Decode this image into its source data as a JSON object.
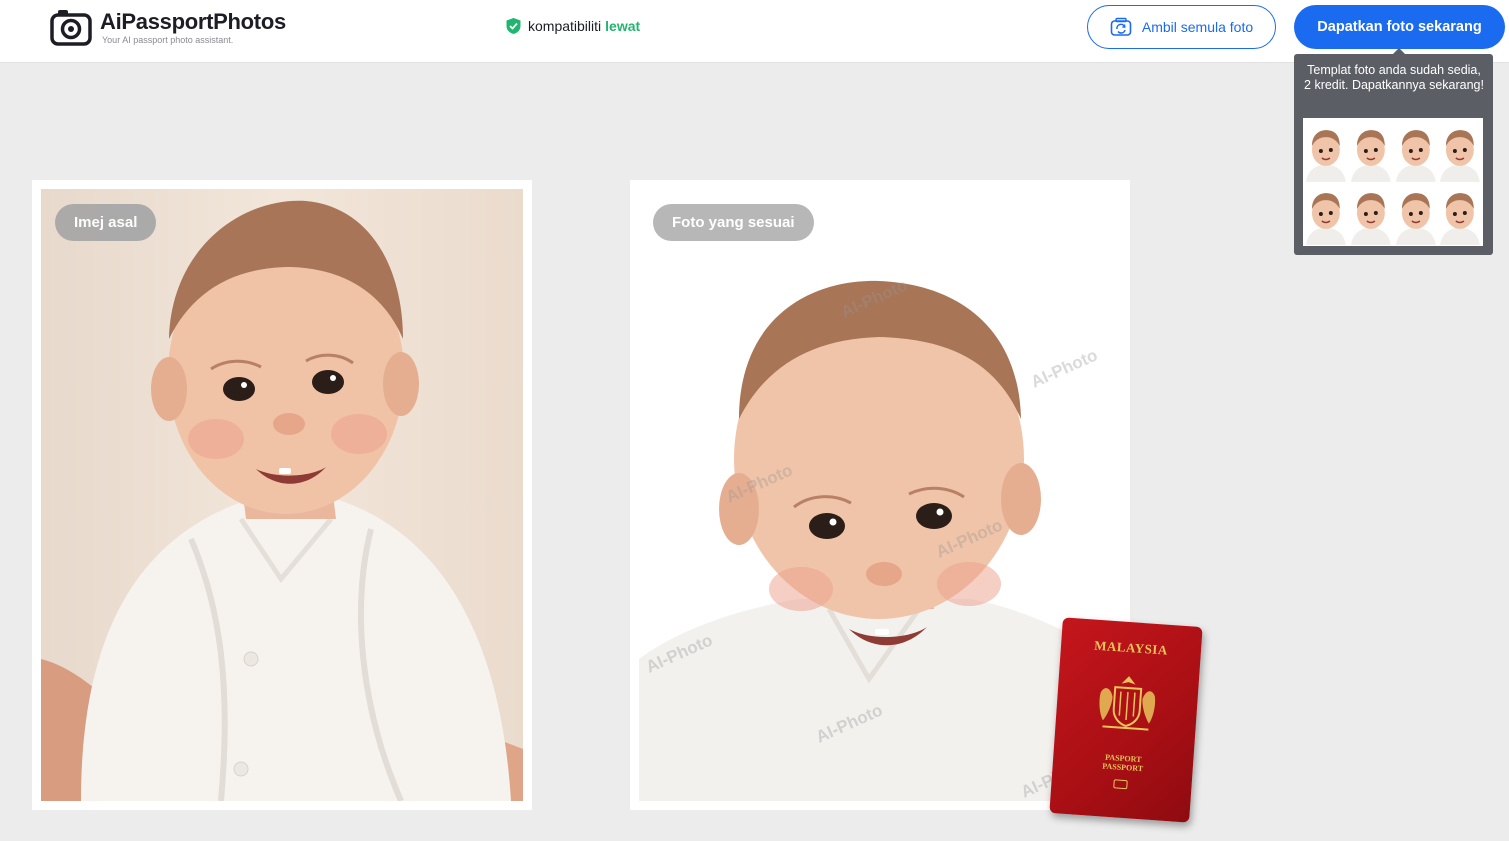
{
  "header": {
    "brand_name": "AiPassportPhotos",
    "brand_tagline": "Your AI passport photo assistant.",
    "compat_label": "kompatibiliti",
    "compat_status": "lewat",
    "retake_label": "Ambil semula foto",
    "get_photo_label": "Dapatkan foto sekarang"
  },
  "tooltip": {
    "text": "Templat foto anda sudah sedia, 2 kredit. Dapatkannya sekarang!",
    "thumbnail_count": 8
  },
  "original_card": {
    "label": "Imej asal"
  },
  "fitted_card": {
    "label": "Foto yang sesuai",
    "watermark": "AI-Photo"
  },
  "passport": {
    "country": "MALAYSIA",
    "type_line1": "PASPORT",
    "type_line2": "PASSPORT"
  },
  "colors": {
    "accent": "#1a6bf0",
    "status_pass": "#21b66f",
    "background": "#ececec",
    "tooltip_bg": "#5c5e66",
    "passport_red": "#c4161c",
    "passport_gold": "#e8c45a"
  }
}
